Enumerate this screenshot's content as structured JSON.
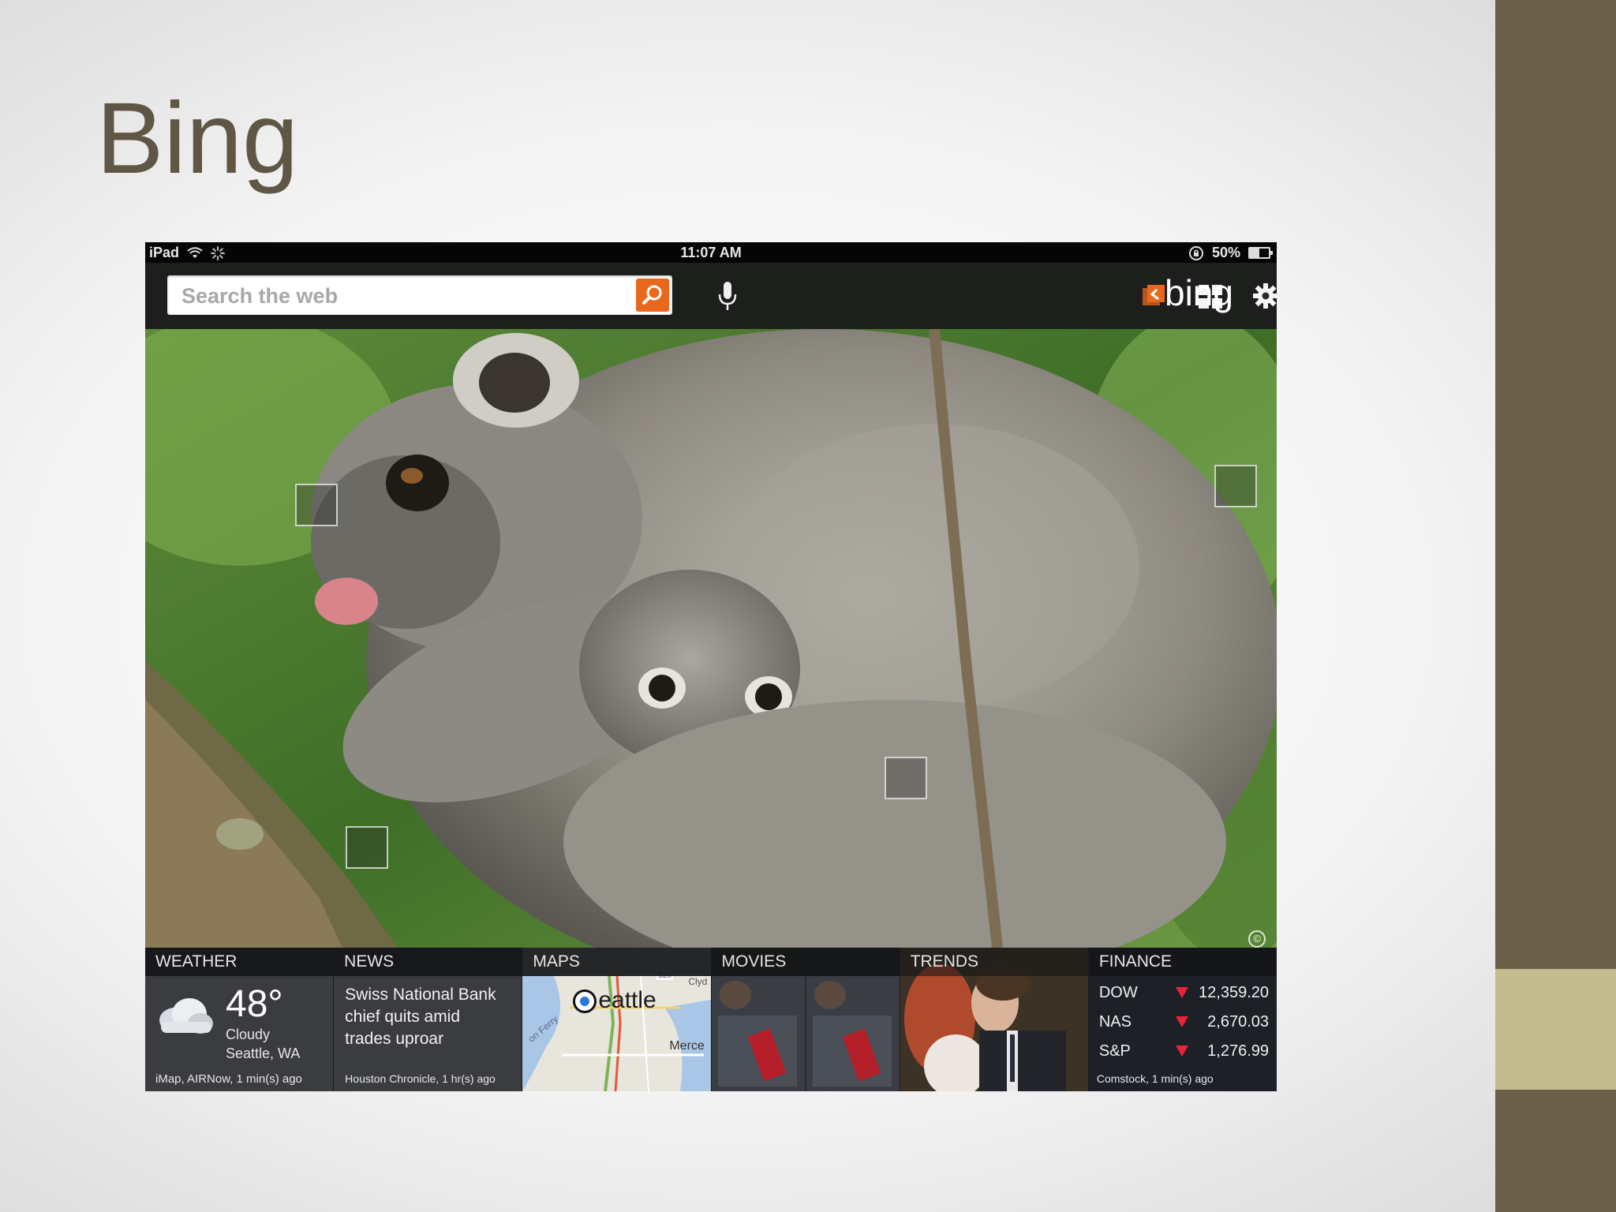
{
  "slide": {
    "title": "Bing"
  },
  "status_bar": {
    "device": "iPad",
    "time": "11:07 AM",
    "battery_text": "50%",
    "battery_level": 0.5
  },
  "toolbar": {
    "search_placeholder": "Search the web",
    "logo": "bing"
  },
  "tiles": {
    "weather": {
      "header": "WEATHER",
      "temp": "48°",
      "condition": "Cloudy",
      "location": "Seattle, WA",
      "source": "iMap, AIRNow, 1 min(s) ago"
    },
    "news": {
      "header": "NEWS",
      "headline": "Swiss National Bank chief quits amid trades uproar",
      "source": "Houston Chronicle, 1 hr(s) ago"
    },
    "maps": {
      "header": "MAPS",
      "city_label": "eattle",
      "label_ferry": "on Ferry",
      "label_mercer": "Merce",
      "label_clyde": "Clyd",
      "label_route": "520"
    },
    "movies": {
      "header": "MOVIES"
    },
    "trends": {
      "header": "TRENDS"
    },
    "finance": {
      "header": "FINANCE",
      "rows": [
        {
          "name": "DOW",
          "value": "12,359.20"
        },
        {
          "name": "NAS",
          "value": "2,670.03"
        },
        {
          "name": "S&P",
          "value": "1,276.99"
        }
      ],
      "source": "Comstock, 1 min(s) ago",
      "down_color": "#e8233a"
    }
  },
  "colors": {
    "side_bar": "#6b5f49",
    "side_accent": "#c4bb8e",
    "title": "#5f5645",
    "search_button": "#e8681e"
  }
}
